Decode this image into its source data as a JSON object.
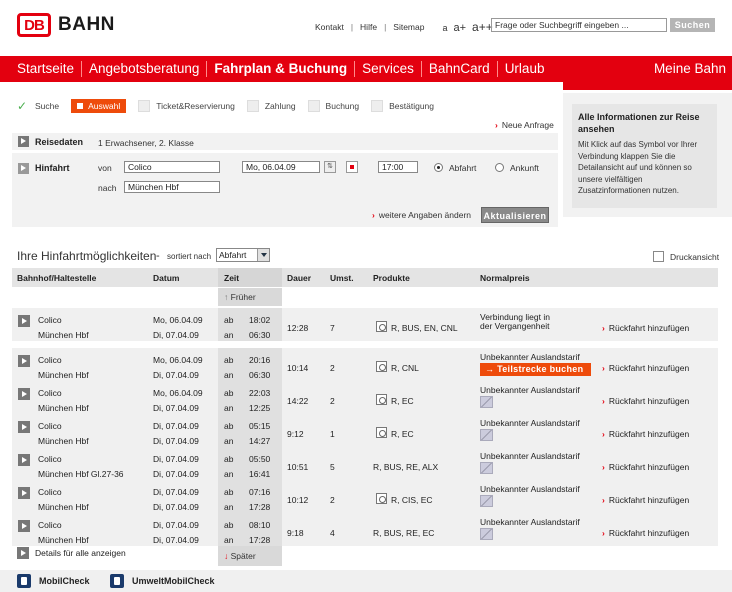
{
  "header": {
    "logo_mark": "DB",
    "logo_text": "BAHN",
    "links": [
      "Kontakt",
      "Hilfe",
      "Sitemap"
    ],
    "font_sizes": [
      "a",
      "a+",
      "a++"
    ],
    "search_placeholder": "Frage oder Suchbegriff eingeben ...",
    "search_button": "Suchen"
  },
  "nav": {
    "items": [
      "Startseite",
      "Angebotsberatung",
      "Fahrplan & Buchung",
      "Services",
      "BahnCard",
      "Urlaub"
    ],
    "active_index": 2,
    "right": "Meine Bahn",
    "accent": "#e3000f"
  },
  "steps": {
    "items": [
      "Suche",
      "Auswahl",
      "Ticket&Reservierung",
      "Zahlung",
      "Buchung",
      "Bestätigung"
    ],
    "active_index": 1,
    "done": [
      "Suche"
    ]
  },
  "neue_anfrage": "Neue Anfrage",
  "reisedaten": {
    "label": "Reisedaten",
    "value": "1 Erwachsener, 2. Klasse"
  },
  "hinfahrt": {
    "label": "Hinfahrt",
    "von_label": "von",
    "von_value": "Colico",
    "nach_label": "nach",
    "nach_value": "München Hbf",
    "date_value": "Mo, 06.04.09",
    "time_value": "17:00",
    "abfahrt_label": "Abfahrt",
    "ankunft_label": "Ankunft",
    "selected": "Abfahrt"
  },
  "weitere_angaben": "weitere Angaben ändern",
  "aktualisieren": "Aktualisieren",
  "info": {
    "title": "Alle Informationen zur Reise ansehen",
    "body": "Mit Klick auf das Symbol vor Ihrer Verbindung klappen Sie die Detailansicht auf und können so unsere vielfältigen Zusatzinformationen nutzen."
  },
  "results": {
    "title": "Ihre Hinfahrtmöglichkeiten",
    "dash": "-",
    "sort_label": "sortiert nach",
    "sort_value": "Abfahrt",
    "druck": "Druckansicht",
    "columns": [
      "Bahnhof/Haltestelle",
      "Datum",
      "Zeit",
      "Dauer",
      "Umst.",
      "Produkte",
      "Normalpreis"
    ],
    "frueher": "Früher",
    "spaeter": "Später",
    "ab": "ab",
    "an": "an",
    "rueckfahrt": "Rückfahrt hinzufügen",
    "teilstrecke": "Teilstrecke buchen",
    "rows": [
      {
        "from": "Colico",
        "to": "München Hbf",
        "date1": "Mo, 06.04.09",
        "date2": "Di, 07.04.09",
        "dep": "18:02",
        "arr": "06:30",
        "dauer": "12:28",
        "umst": "7",
        "produkte": "R, BUS, EN, CNL",
        "has_pic": true,
        "preis1": "Verbindung liegt in",
        "preis2": "der Vergangenheit",
        "teil": false,
        "mail": false
      },
      {
        "from": "Colico",
        "to": "München Hbf",
        "date1": "Mo, 06.04.09",
        "date2": "Di, 07.04.09",
        "dep": "20:16",
        "arr": "06:30",
        "dauer": "10:14",
        "umst": "2",
        "produkte": "R, CNL",
        "has_pic": true,
        "preis1": "Unbekannter Auslandstarif",
        "preis2": "",
        "teil": true,
        "mail": false
      },
      {
        "from": "Colico",
        "to": "München Hbf",
        "date1": "Mo, 06.04.09",
        "date2": "Di, 07.04.09",
        "dep": "22:03",
        "arr": "12:25",
        "dauer": "14:22",
        "umst": "2",
        "produkte": "R, EC",
        "has_pic": true,
        "preis1": "Unbekannter Auslandstarif",
        "preis2": "",
        "teil": false,
        "mail": true
      },
      {
        "from": "Colico",
        "to": "München Hbf",
        "date1": "Di, 07.04.09",
        "date2": "Di, 07.04.09",
        "dep": "05:15",
        "arr": "14:27",
        "dauer": "9:12",
        "umst": "1",
        "produkte": "R, EC",
        "has_pic": true,
        "preis1": "Unbekannter Auslandstarif",
        "preis2": "",
        "teil": false,
        "mail": true
      },
      {
        "from": "Colico",
        "to": "München Hbf Gl.27-36",
        "date1": "Di, 07.04.09",
        "date2": "Di, 07.04.09",
        "dep": "05:50",
        "arr": "16:41",
        "dauer": "10:51",
        "umst": "5",
        "produkte": "R, BUS, RE, ALX",
        "has_pic": false,
        "preis1": "Unbekannter Auslandstarif",
        "preis2": "",
        "teil": false,
        "mail": true
      },
      {
        "from": "Colico",
        "to": "München Hbf",
        "date1": "Di, 07.04.09",
        "date2": "Di, 07.04.09",
        "dep": "07:16",
        "arr": "17:28",
        "dauer": "10:12",
        "umst": "2",
        "produkte": "R, CIS, EC",
        "has_pic": true,
        "preis1": "Unbekannter Auslandstarif",
        "preis2": "",
        "teil": false,
        "mail": true
      },
      {
        "from": "Colico",
        "to": "München Hbf",
        "date1": "Di, 07.04.09",
        "date2": "Di, 07.04.09",
        "dep": "08:10",
        "arr": "17:28",
        "dauer": "9:18",
        "umst": "4",
        "produkte": "R, BUS, RE, EC",
        "has_pic": false,
        "preis1": "Unbekannter Auslandstarif",
        "preis2": "",
        "teil": false,
        "mail": true
      }
    ]
  },
  "details_all": "Details für alle anzeigen",
  "footer": {
    "items": [
      "MobilCheck",
      "UmweltMobilCheck"
    ]
  }
}
